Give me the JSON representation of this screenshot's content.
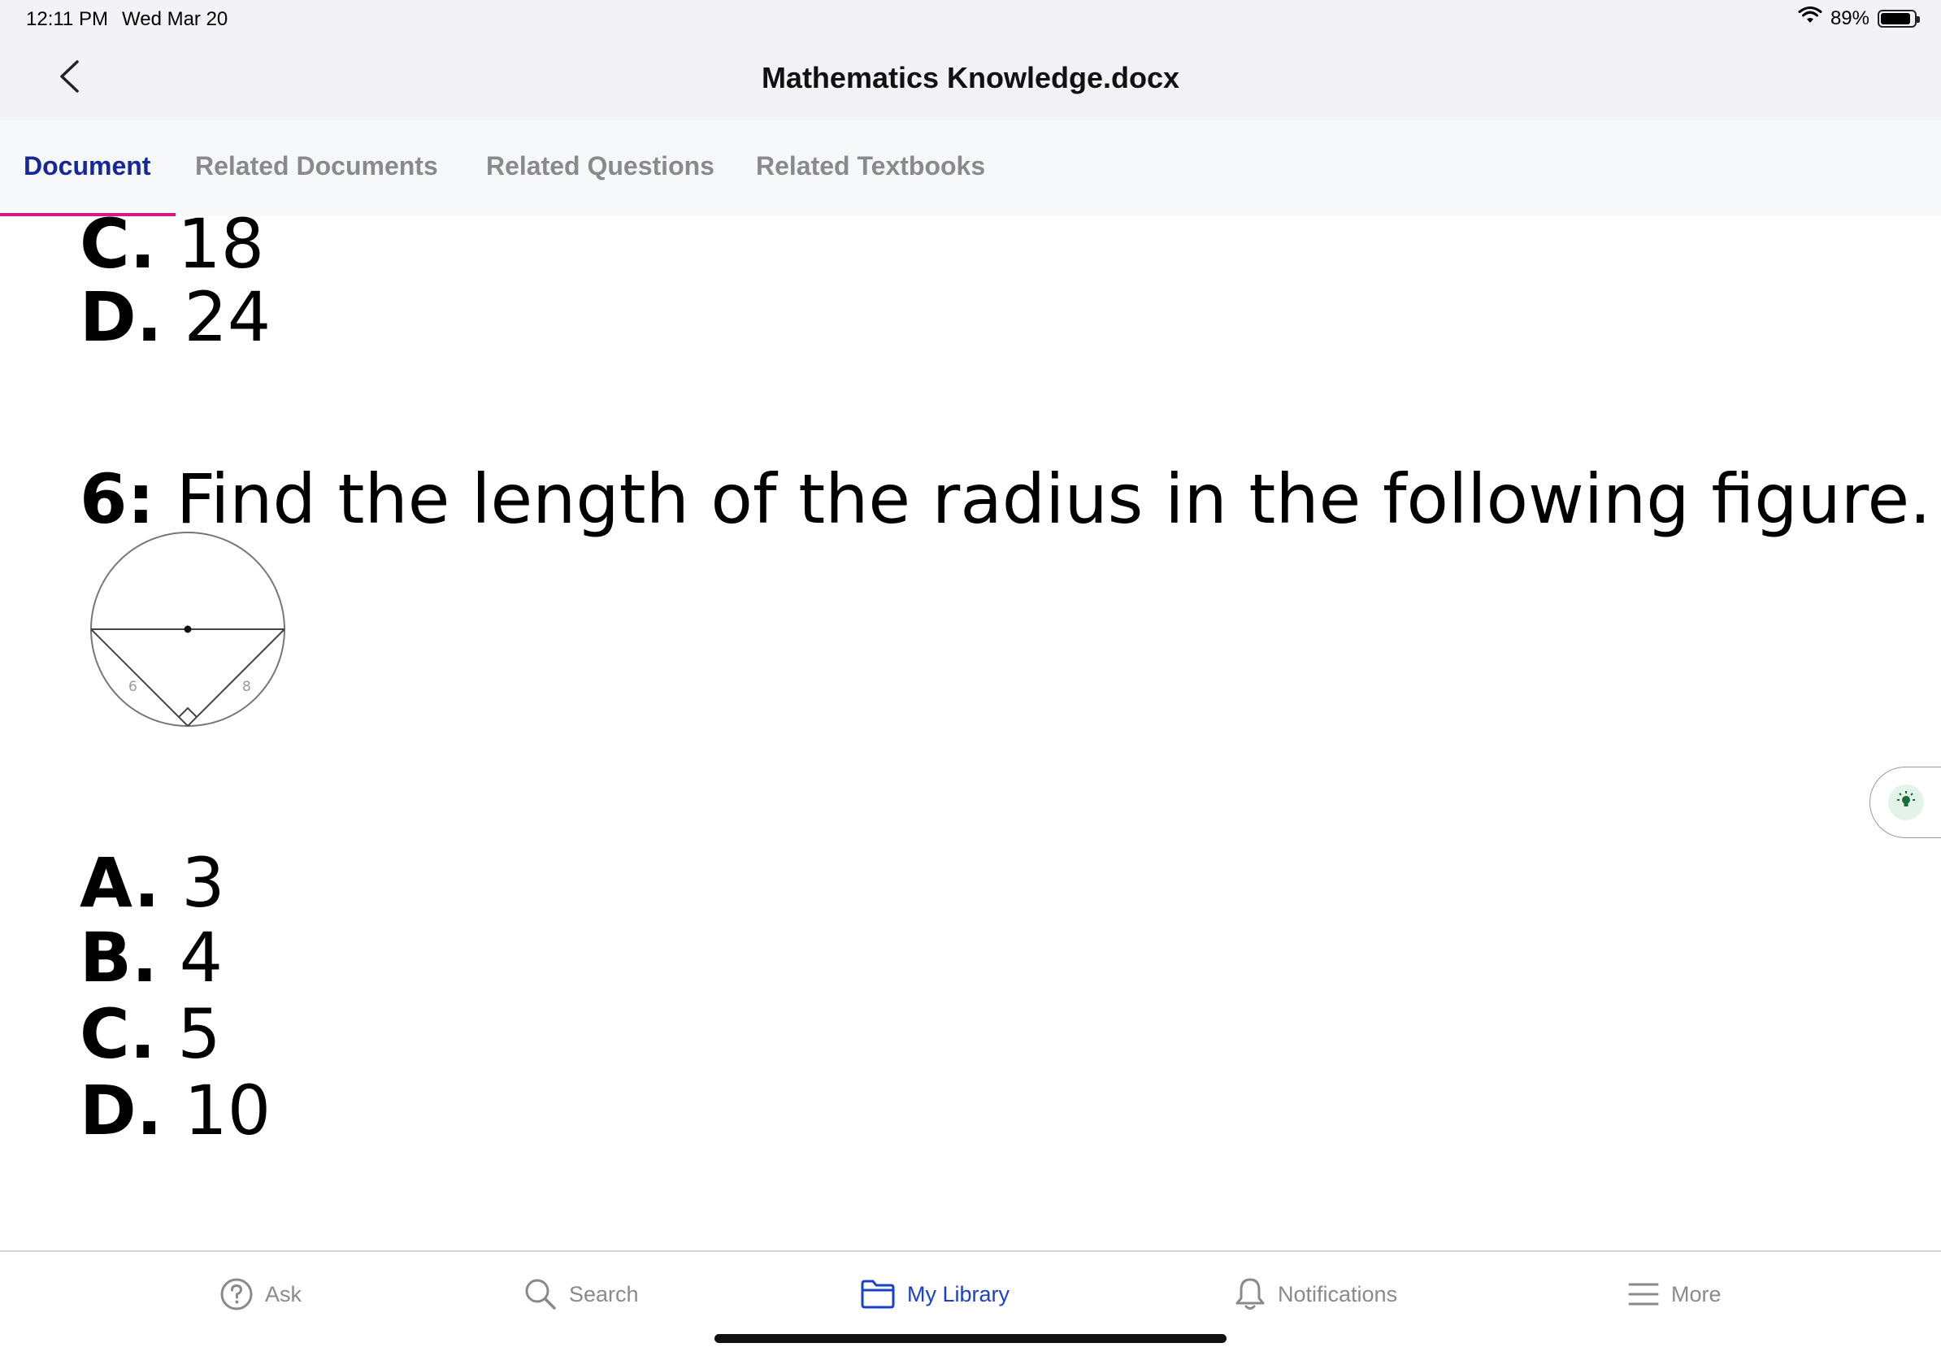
{
  "status_bar": {
    "time": "12:11 PM",
    "date": "Wed Mar 20",
    "battery": "89%",
    "battery_level": 0.89
  },
  "header": {
    "title": "Mathematics Knowledge.docx",
    "back_icon": "chevron-left-icon"
  },
  "tabs": [
    {
      "label": "Document",
      "active": true
    },
    {
      "label": "Related Documents",
      "active": false
    },
    {
      "label": "Related Questions",
      "active": false
    },
    {
      "label": "Related Textbooks",
      "active": false
    }
  ],
  "document": {
    "prev_options": [
      {
        "letter": "C.",
        "value": "18"
      },
      {
        "letter": "D.",
        "value": "24"
      }
    ],
    "question": {
      "number": "6:",
      "text": "Find the length of the radius in the following figure."
    },
    "figure": {
      "label_left": "6",
      "label_right": "8"
    },
    "options": [
      {
        "letter": "A.",
        "value": "3"
      },
      {
        "letter": "B.",
        "value": "4"
      },
      {
        "letter": "C.",
        "value": "5"
      },
      {
        "letter": "D.",
        "value": "10"
      }
    ]
  },
  "hint_button": {
    "icon": "lightbulb-icon"
  },
  "bottom_nav": [
    {
      "label": "Ask",
      "icon": "question-circle-icon",
      "active": false
    },
    {
      "label": "Search",
      "icon": "search-icon",
      "active": false
    },
    {
      "label": "My Library",
      "icon": "folder-icon",
      "active": true
    },
    {
      "label": "Notifications",
      "icon": "bell-icon",
      "active": false
    },
    {
      "label": "More",
      "icon": "menu-icon",
      "active": false
    }
  ],
  "colors": {
    "accent": "#14279b",
    "tab_underline": "#d6198a",
    "nav_active": "#1a40c8",
    "inactive": "#8a8a8e"
  }
}
